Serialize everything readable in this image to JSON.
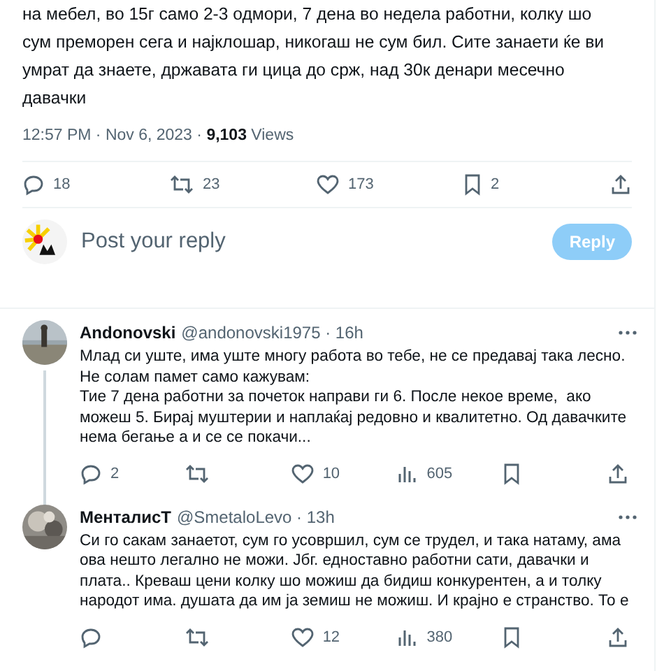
{
  "tweet": {
    "text": "на мебел, во 15г само 2-3 одмори, 7 дена во недела работни, колку шо\nсум преморен сега и најклошар, никогаш не сум бил. Сите занаети ќе ви\nумрат да знаете, државата ги цица до срж, над 30к денари месечно\nдавачки",
    "meta": "12:57 PM · Nov 6, 2023 · **9,103** Views",
    "actions": [
      {
        "kind": "reply",
        "count": "18"
      },
      {
        "kind": "repost",
        "count": "23"
      },
      {
        "kind": "like",
        "count": "173"
      },
      {
        "kind": "bookmark",
        "count": "2"
      },
      {
        "kind": "share"
      }
    ]
  },
  "composer": {
    "placeholder": "Post your reply",
    "button": "Reply",
    "disabled": true
  },
  "replies": [
    {
      "name": "Andonovski",
      "handle": "@andonovski1975 · 16h",
      "thread": true,
      "text": "Млад си уште, има уште многу работа во тебе, не се предавај така лесно.\nНе солам памет само кажувам:\nТие 7 дена работни за почеток направи ги 6. После некое време,  ако\nможеш 5. Бирај муштерии и наплаќај редовно и квалитетно. Од давачките\nнема бегање а и се се покачи...",
      "actions": [
        {
          "kind": "reply",
          "count": "2"
        },
        {
          "kind": "repost"
        },
        {
          "kind": "like",
          "count": "10"
        },
        {
          "kind": "views",
          "count": "605"
        },
        {
          "kind": "bookmark"
        },
        {
          "kind": "share"
        }
      ]
    },
    {
      "name": "МенталисТ",
      "handle": "@SmetaloLevo · 13h",
      "thread": false,
      "text": "Си го сакам занаетот, сум го усовршил, сум се трудел, и така натаму, ама\nова нешто легално не можи. Јбг. едноставно работни сати, давачки и\nплата.. Креваш цени колку шо можиш да бидиш конкурентен, а и толку\nнародот има. душата да им ја земиш не можиш. И крајно е странство. То е",
      "actions": [
        {
          "kind": "reply"
        },
        {
          "kind": "repost"
        },
        {
          "kind": "like",
          "count": "12"
        },
        {
          "kind": "views",
          "count": "380"
        },
        {
          "kind": "bookmark"
        },
        {
          "kind": "share"
        }
      ]
    }
  ]
}
